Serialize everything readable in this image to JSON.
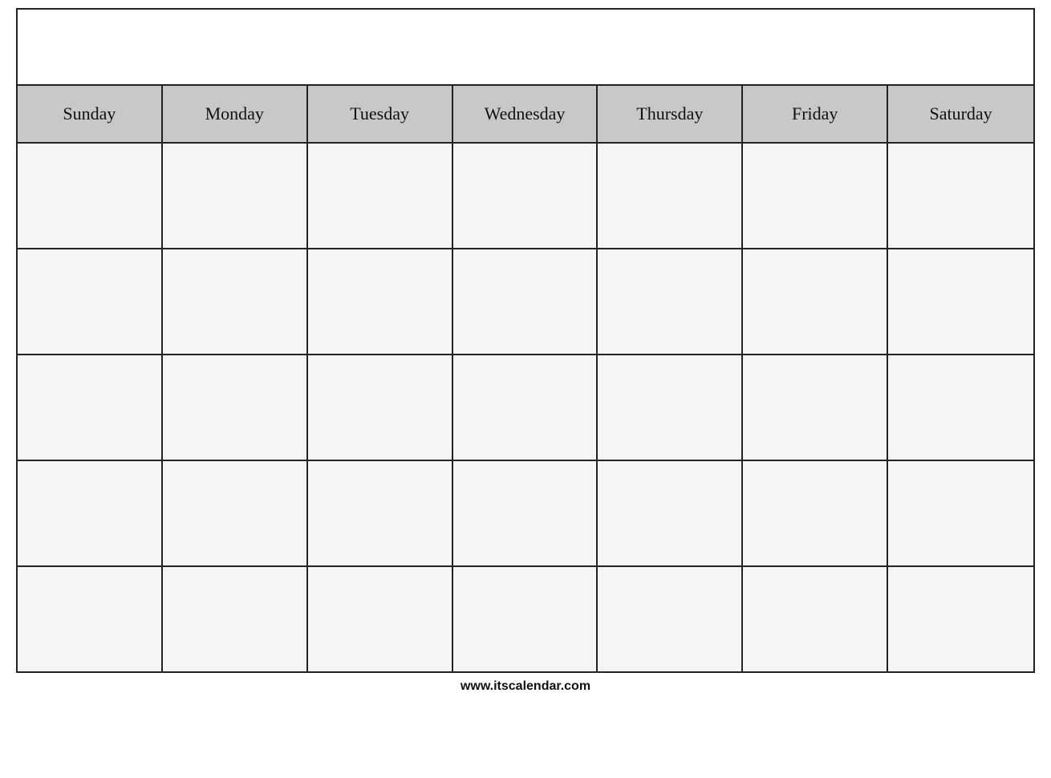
{
  "calendar": {
    "days": [
      "Sunday",
      "Monday",
      "Tuesday",
      "Wednesday",
      "Thursday",
      "Friday",
      "Saturday"
    ],
    "rows": 5
  },
  "footer": {
    "url": "www.itscalendar.com"
  }
}
